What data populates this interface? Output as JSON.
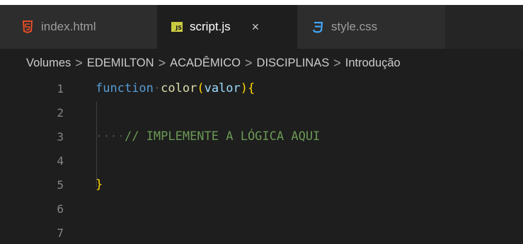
{
  "tabs": [
    {
      "label": "index.html",
      "icon": "html5-icon",
      "active": false
    },
    {
      "label": "script.js",
      "icon": "js-icon",
      "badge": "JS",
      "active": true,
      "close": "×"
    },
    {
      "label": "style.css",
      "icon": "css3-icon",
      "active": false
    }
  ],
  "breadcrumb": [
    "Volumes",
    "EDEMILTON",
    "ACADÊMICO",
    "DISCIPLINAS",
    "Introdução"
  ],
  "breadcrumb_separator": ">",
  "editor": {
    "lines": [
      {
        "number": "1",
        "keyword": "function",
        "func": "color",
        "open_paren": "(",
        "param": "valor",
        "close_paren": ")",
        "brace": "{"
      },
      {
        "number": "2"
      },
      {
        "number": "3",
        "comment": "// IMPLEMENTE A LÓGICA AQUI"
      },
      {
        "number": "4"
      },
      {
        "number": "5",
        "brace": "}"
      },
      {
        "number": "6"
      },
      {
        "number": "7"
      }
    ]
  },
  "colors": {
    "editor_bg": "#1e1e1e",
    "tabbar_bg": "#252526",
    "keyword": "#569cd6",
    "function": "#dcdcaa",
    "param": "#9cdcfe",
    "brace": "#ffd700",
    "comment": "#6a9955",
    "html_icon": "#e44d26",
    "css_icon": "#42a5f5",
    "js_icon": "#cbcb41"
  }
}
